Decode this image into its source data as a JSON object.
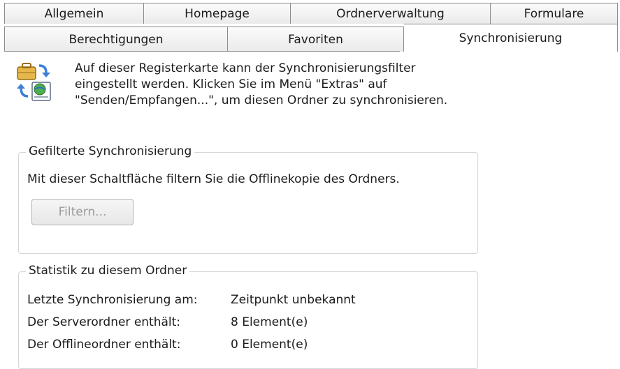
{
  "tabs": {
    "row1": [
      {
        "label": "Allgemein"
      },
      {
        "label": "Homepage"
      },
      {
        "label": "Ordnerverwaltung"
      },
      {
        "label": "Formulare"
      }
    ],
    "row2": [
      {
        "label": "Berechtigungen"
      },
      {
        "label": "Favoriten"
      },
      {
        "label": "Synchronisierung"
      }
    ],
    "active": "Synchronisierung"
  },
  "info": {
    "icon": "sync-folder-icon",
    "text": "Auf dieser Registerkarte kann der Synchronisierungsfilter eingestellt werden. Klicken Sie im Menü \"Extras\" auf \"Senden/Empfangen...\", um diesen Ordner zu synchronisieren."
  },
  "filter_group": {
    "title": "Gefilterte Synchronisierung",
    "description": "Mit dieser Schaltfläche filtern Sie die Offlinekopie des Ordners.",
    "button_label": "Filtern...",
    "button_enabled": false
  },
  "stats_group": {
    "title": "Statistik zu diesem Ordner",
    "rows": [
      {
        "label": "Letzte Synchronisierung am:",
        "value": "Zeitpunkt unbekannt"
      },
      {
        "label": "Der Serverordner enthält:",
        "value": "8 Element(e)"
      },
      {
        "label": "Der Offlineordner enthält:",
        "value": "0 Element(e)"
      }
    ]
  },
  "colors": {
    "border": "#8c8c8c",
    "group_border": "#d5d5d5",
    "disabled_text": "#9b9b9b"
  }
}
